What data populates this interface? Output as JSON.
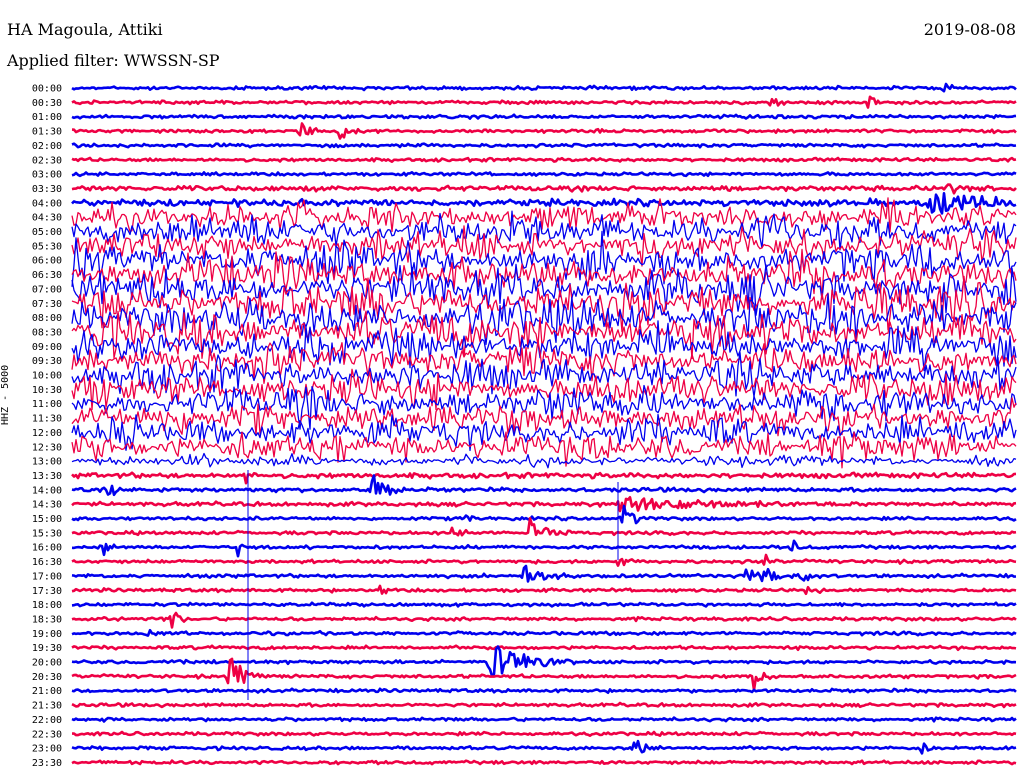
{
  "header": {
    "station": "HA Magoula, Attiki",
    "filter": "Applied filter: WWSSN-SP",
    "date": "2019-08-08"
  },
  "chart_data": {
    "type": "line",
    "title": "HA Magoula, Attiki",
    "subtitle": "Applied filter: WWSSN-SP",
    "date": "2019-08-08",
    "ylabel": "HHZ - 5000",
    "xlabel": "",
    "colors": {
      "even": "#0000ee",
      "odd": "#ee0044"
    },
    "rows": [
      {
        "t": "00:00",
        "amp": 1.0,
        "events": [
          [
            945,
            10,
            2.0
          ]
        ]
      },
      {
        "t": "00:30",
        "amp": 1.0,
        "events": [
          [
            772,
            8,
            3.0
          ],
          [
            868,
            10,
            3.0
          ]
        ]
      },
      {
        "t": "01:00",
        "amp": 1.0,
        "events": []
      },
      {
        "t": "01:30",
        "amp": 1.0,
        "events": [
          [
            300,
            10,
            3.0
          ],
          [
            340,
            10,
            3.0
          ]
        ]
      },
      {
        "t": "02:00",
        "amp": 1.0,
        "events": []
      },
      {
        "t": "02:30",
        "amp": 1.0,
        "events": []
      },
      {
        "t": "03:00",
        "amp": 1.0,
        "events": []
      },
      {
        "t": "03:30",
        "amp": 1.5,
        "events": [
          [
            948,
            6,
            4.0
          ]
        ]
      },
      {
        "t": "04:00",
        "amp": 2.0,
        "events": [
          [
            930,
            60,
            4.0
          ]
        ]
      },
      {
        "t": "04:30",
        "amp": 10.0,
        "events": []
      },
      {
        "t": "05:00",
        "amp": 12.0,
        "events": []
      },
      {
        "t": "05:30",
        "amp": 12.0,
        "events": []
      },
      {
        "t": "06:00",
        "amp": 13.0,
        "events": []
      },
      {
        "t": "06:30",
        "amp": 13.0,
        "events": []
      },
      {
        "t": "07:00",
        "amp": 14.0,
        "events": []
      },
      {
        "t": "07:30",
        "amp": 15.0,
        "events": []
      },
      {
        "t": "08:00",
        "amp": 15.0,
        "events": []
      },
      {
        "t": "08:30",
        "amp": 14.0,
        "events": []
      },
      {
        "t": "09:00",
        "amp": 13.0,
        "events": []
      },
      {
        "t": "09:30",
        "amp": 12.0,
        "events": []
      },
      {
        "t": "10:00",
        "amp": 12.0,
        "events": []
      },
      {
        "t": "10:30",
        "amp": 12.0,
        "events": []
      },
      {
        "t": "11:00",
        "amp": 12.0,
        "events": []
      },
      {
        "t": "11:30",
        "amp": 11.0,
        "events": []
      },
      {
        "t": "12:00",
        "amp": 11.0,
        "events": []
      },
      {
        "t": "12:30",
        "amp": 11.0,
        "events": []
      },
      {
        "t": "13:00",
        "amp": 4.0,
        "events": [
          [
            270,
            40,
            2.0
          ]
        ]
      },
      {
        "t": "13:30",
        "amp": 1.5,
        "events": [
          [
            248,
            4,
            6.0
          ]
        ]
      },
      {
        "t": "14:00",
        "amp": 1.2,
        "events": [
          [
            372,
            14,
            6.0
          ],
          [
            110,
            4,
            4.0
          ]
        ]
      },
      {
        "t": "14:30",
        "amp": 1.2,
        "events": [
          [
            620,
            100,
            2.5
          ]
        ]
      },
      {
        "t": "15:00",
        "amp": 1.0,
        "events": [
          [
            620,
            10,
            6.0
          ],
          [
            462,
            6,
            3.0
          ]
        ]
      },
      {
        "t": "15:30",
        "amp": 1.0,
        "events": [
          [
            530,
            15,
            5.0
          ],
          [
            450,
            12,
            2.5
          ]
        ]
      },
      {
        "t": "16:00",
        "amp": 1.0,
        "events": [
          [
            104,
            4,
            3.0
          ],
          [
            793,
            4,
            3.0
          ],
          [
            238,
            4,
            3.0
          ]
        ]
      },
      {
        "t": "16:30",
        "amp": 1.0,
        "events": [
          [
            620,
            6,
            3.0
          ],
          [
            765,
            4,
            3.0
          ]
        ]
      },
      {
        "t": "17:00",
        "amp": 1.0,
        "events": [
          [
            525,
            20,
            4.0
          ],
          [
            748,
            10,
            4.0
          ],
          [
            763,
            10,
            4.0
          ],
          [
            800,
            10,
            3.0
          ]
        ]
      },
      {
        "t": "17:30",
        "amp": 1.0,
        "events": [
          [
            808,
            6,
            3.0
          ],
          [
            380,
            6,
            2.0
          ]
        ]
      },
      {
        "t": "18:00",
        "amp": 1.0,
        "events": []
      },
      {
        "t": "18:30",
        "amp": 1.0,
        "events": [
          [
            172,
            8,
            4.0
          ]
        ]
      },
      {
        "t": "19:00",
        "amp": 1.0,
        "events": [
          [
            148,
            4,
            2.5
          ]
        ]
      },
      {
        "t": "19:30",
        "amp": 1.0,
        "events": []
      },
      {
        "t": "20:00",
        "amp": 1.0,
        "events": [
          [
            490,
            30,
            8.0
          ]
        ]
      },
      {
        "t": "20:30",
        "amp": 1.0,
        "events": [
          [
            230,
            12,
            8.0
          ],
          [
            753,
            8,
            5.0
          ]
        ]
      },
      {
        "t": "21:00",
        "amp": 1.0,
        "events": []
      },
      {
        "t": "21:30",
        "amp": 1.0,
        "events": []
      },
      {
        "t": "22:00",
        "amp": 1.0,
        "events": []
      },
      {
        "t": "22:30",
        "amp": 1.0,
        "events": []
      },
      {
        "t": "23:00",
        "amp": 1.0,
        "events": [
          [
            636,
            8,
            4.0
          ],
          [
            922,
            6,
            3.0
          ]
        ]
      },
      {
        "t": "23:30",
        "amp": 1.0,
        "events": []
      }
    ],
    "grid": false
  }
}
